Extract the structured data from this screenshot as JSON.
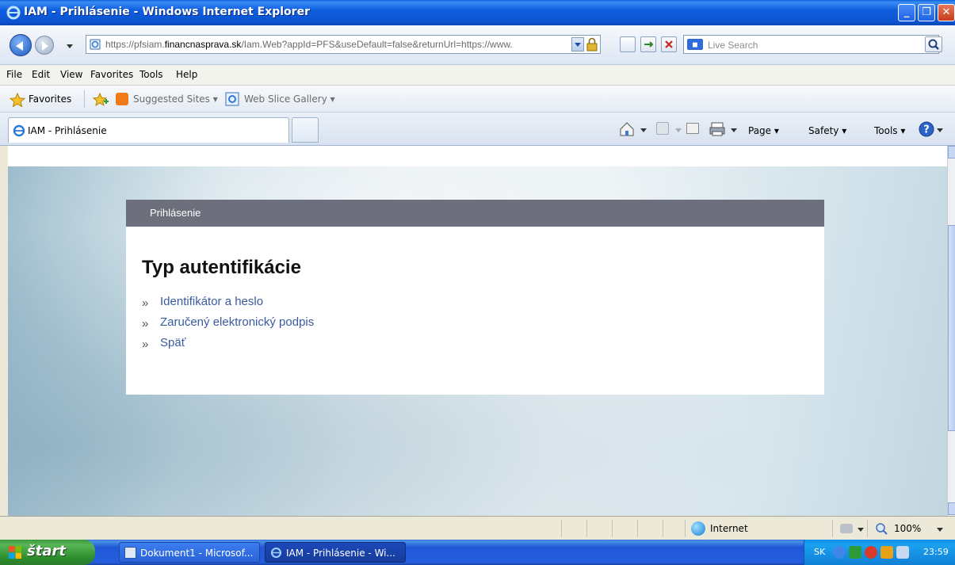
{
  "window": {
    "title": "IAM - Prihlásenie - Windows Internet Explorer"
  },
  "address_bar": {
    "url_prefix": "https://pfsiam.",
    "url_domain": "financnasprava.sk",
    "url_suffix": "/Iam.Web?appId=PFS&useDefault=false&returnUrl=https://www."
  },
  "search": {
    "placeholder": "Live Search",
    "logo": "live-icon"
  },
  "menu": {
    "items": [
      "File",
      "Edit",
      "View",
      "Favorites",
      "Tools",
      "Help"
    ]
  },
  "favorites_bar": {
    "label": "Favorites",
    "items": [
      "Suggested Sites ▾",
      "Web Slice Gallery ▾"
    ]
  },
  "tabs": [
    {
      "title": "IAM - Prihlásenie",
      "active": true
    }
  ],
  "command_bar": {
    "page": "Page ▾",
    "safety": "Safety ▾",
    "tools": "Tools ▾"
  },
  "page": {
    "panel_header": "Prihlásenie",
    "heading": "Typ autentifikácie",
    "bullet": "»",
    "links": [
      {
        "label": "Identifikátor a heslo"
      },
      {
        "label": "Zaručený elektronický podpis"
      },
      {
        "label": "Späť"
      }
    ]
  },
  "status_bar": {
    "zone": "Internet",
    "zoom": "100%"
  },
  "taskbar": {
    "start_label": "štart",
    "tasks": [
      {
        "label": "Dokument1 - Microsof..."
      },
      {
        "label": "IAM - Prihlásenie - Wi..."
      }
    ],
    "language": "SK",
    "clock": "23:59"
  },
  "colors": {
    "title_bar": "#0b52cf",
    "panel_header": "#6d707c",
    "link": "#3a5aa0",
    "taskbar": "#245edc",
    "start_button": "#3c9a3c"
  }
}
